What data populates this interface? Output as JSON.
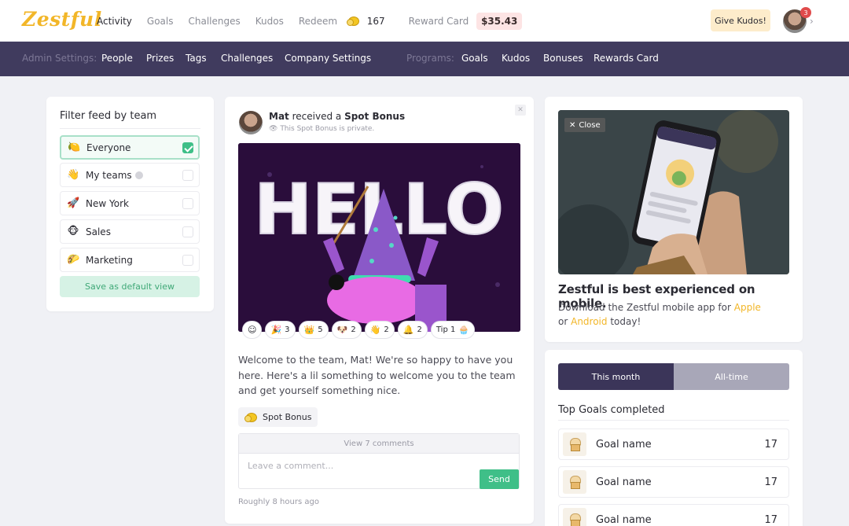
{
  "app": {
    "name": "Zestful"
  },
  "nav": {
    "items": [
      "Activity",
      "Goals",
      "Challenges",
      "Kudos",
      "Redeem"
    ],
    "redeem_count": "167",
    "reward_card_label": "Reward Card",
    "reward_card_amount": "$35.43",
    "give_kudos": "Give Kudos!",
    "notification_count": "3"
  },
  "admin": {
    "settings_label": "Admin Settings:",
    "settings_links": [
      "People",
      "Prizes",
      "Tags",
      "Challenges",
      "Company Settings"
    ],
    "programs_label": "Programs:",
    "program_links": [
      "Goals",
      "Kudos",
      "Bonuses",
      "Rewards Card"
    ]
  },
  "filter": {
    "title": "Filter feed by team",
    "teams": [
      {
        "name": "Everyone",
        "icon": "lemon-icon",
        "checked": true
      },
      {
        "name": "My teams",
        "icon": "waving-hand-icon",
        "checked": false
      },
      {
        "name": "New York",
        "icon": "rocket-icon",
        "checked": false
      },
      {
        "name": "Sales",
        "icon": "monkey-icon",
        "checked": false
      },
      {
        "name": "Marketing",
        "icon": "taco-icon",
        "checked": false
      }
    ],
    "save_default": "Save as default view"
  },
  "post": {
    "author": "Mat",
    "action": "received a",
    "bonus_type": "Spot Bonus",
    "privacy_note": "This Spot Bonus is private.",
    "image_text": "HELLO",
    "reactions": [
      {
        "emoji": "🎉",
        "count": "3"
      },
      {
        "emoji": "👑",
        "count": "5"
      },
      {
        "emoji": "🐶",
        "count": "2"
      },
      {
        "emoji": "👋",
        "count": "2"
      },
      {
        "emoji": "🔔",
        "count": "2"
      }
    ],
    "tip_label": "Tip 1",
    "message": "Welcome to the team, Mat! We're so happy to have you here. Here's a lil something to welcome you to the team and get yourself something nice.",
    "chip_label": "Spot Bonus",
    "view_comments": "View 7 comments",
    "comment_placeholder": "Leave a comment...",
    "send": "Send",
    "timestamp": "Roughly 8 hours ago"
  },
  "mobile_promo": {
    "close": "Close",
    "headline": "Zestful is best experienced on mobile.",
    "text_before": "Download the Zestful mobile app for",
    "apple": "Apple",
    "or": "or",
    "android": "Android",
    "text_after": "today!"
  },
  "leaderboard": {
    "tabs": [
      "This month",
      "All-time"
    ],
    "active_tab": 0,
    "title": "Top Goals completed",
    "rows": [
      {
        "name": "Goal name",
        "value": "17"
      },
      {
        "name": "Goal name",
        "value": "17"
      },
      {
        "name": "Goal name",
        "value": "17"
      }
    ]
  }
}
